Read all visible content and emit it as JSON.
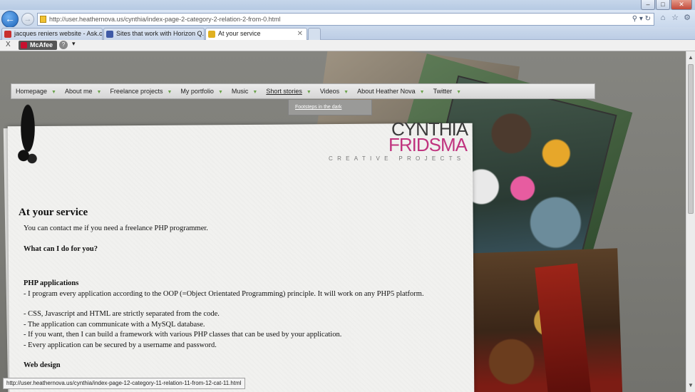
{
  "browser": {
    "address_url": "http://user.heathernova.us/cynthia/index-page-2-category-2-relation-2-from-0.html",
    "tabs": [
      {
        "label": "jacques reniers website - Ask.c...",
        "icon_color": "#c8302e"
      },
      {
        "label": "Sites that work with Horizon Q...",
        "icon_color": "#3f5aa6"
      },
      {
        "label": "At your service",
        "icon_color": "#e0b020",
        "active": true
      }
    ],
    "toolbar": {
      "close_label": "X",
      "mcafee_label": "McAfee",
      "help_label": "?",
      "dropdown_label": "▾"
    },
    "status_url": "http://user.heathernova.us/cynthia/index-page-12-category-11-relation-11-from-12-cat-11.html"
  },
  "menu": {
    "items": [
      {
        "label": "Homepage"
      },
      {
        "label": "About me"
      },
      {
        "label": "Freelance projects"
      },
      {
        "label": "My portfolio"
      },
      {
        "label": "Music"
      },
      {
        "label": "Short stories"
      },
      {
        "label": "Videos"
      },
      {
        "label": "About Heather Nova"
      },
      {
        "label": "Twitter"
      }
    ],
    "submenu_item": "Footsteps in the dark"
  },
  "logo": {
    "line1": "CYNTHIA",
    "line2": "FRIDSMA",
    "tagline": "CREATIVE PROJECTS"
  },
  "content": {
    "title": "At your service",
    "intro": "You can contact me if you need a freelance PHP programmer.",
    "question": "What can I do for you?",
    "php_heading": "PHP applications",
    "php_p1": "- I program every application according to the OOP (=Object Orientated Programming) principle. It will work on any PHP5 platform.",
    "php_lines": [
      "- CSS, Javascript and HTML are strictly separated from the code.",
      "- The application can communicate with a MySQL database.",
      "- If you want, then I can build a framework with various PHP classes that can be used by your application.",
      "- Every application can be secured by a username and password."
    ],
    "web_heading": "Web design"
  }
}
